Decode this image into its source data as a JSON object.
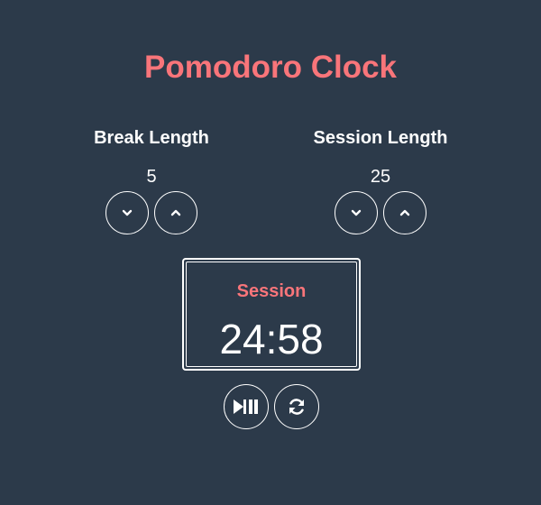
{
  "app": {
    "title": "Pomodoro Clock"
  },
  "break": {
    "label": "Break Length",
    "value": "5",
    "decrement_icon": "chevron-down-icon",
    "increment_icon": "chevron-up-icon"
  },
  "session": {
    "label": "Session Length",
    "value": "25",
    "decrement_icon": "chevron-down-icon",
    "increment_icon": "chevron-up-icon"
  },
  "timer": {
    "label": "Session",
    "time": "24:58",
    "play_pause_icon": "play-pause-icon",
    "reset_icon": "refresh-icon"
  },
  "colors": {
    "background": "#2c3a4a",
    "accent": "#f9757a",
    "text": "#ffffff"
  }
}
